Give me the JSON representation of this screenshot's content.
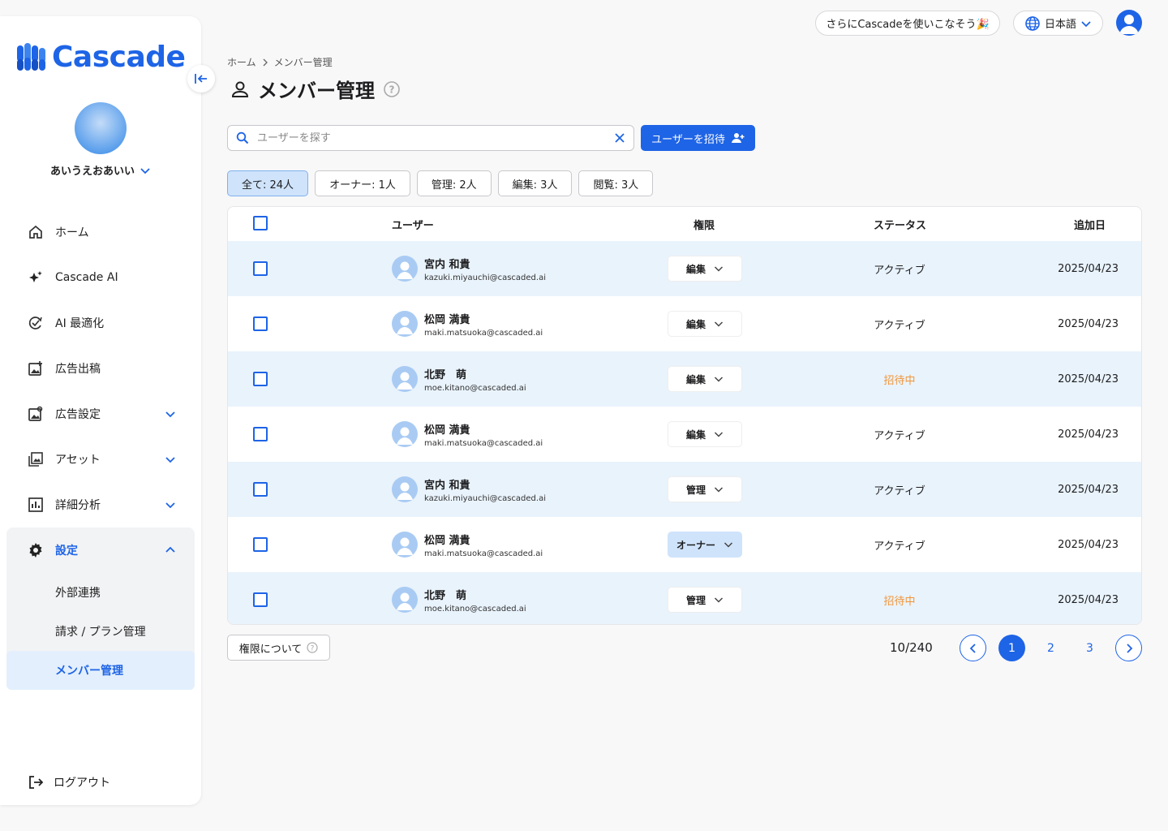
{
  "brand": {
    "name": "Cascade",
    "color": "#1e64e6"
  },
  "sidebar": {
    "org_name": "あいうえおあいい",
    "items": [
      {
        "label": "ホーム",
        "icon": "home-icon"
      },
      {
        "label": "Cascade AI",
        "icon": "sparkle-icon"
      },
      {
        "label": "AI 最適化",
        "icon": "optimize-icon"
      },
      {
        "label": "広告出稿",
        "icon": "ad-upload-icon"
      },
      {
        "label": "広告設定",
        "icon": "ad-settings-icon"
      },
      {
        "label": "アセット",
        "icon": "gallery-icon"
      },
      {
        "label": "詳細分析",
        "icon": "analytics-icon"
      },
      {
        "label": "設定",
        "icon": "gear-icon"
      }
    ],
    "sub_items": [
      {
        "label": "外部連携"
      },
      {
        "label": "請求 / プラン管理"
      },
      {
        "label": "メンバー管理"
      }
    ],
    "logout": "ログアウト"
  },
  "topbar": {
    "promo": "さらにCascadeを使いこなそう🎉",
    "language": "日本語"
  },
  "header": {
    "breadcrumb": [
      "ホーム",
      "メンバー管理"
    ],
    "title": "メンバー管理"
  },
  "search": {
    "placeholder": "ユーザーを探す",
    "value": ""
  },
  "invite_label": "ユーザーを招待",
  "filters": [
    {
      "label": "全て: 24人",
      "active": true
    },
    {
      "label": "オーナー: 1人",
      "active": false
    },
    {
      "label": "管理: 2人",
      "active": false
    },
    {
      "label": "編集: 3人",
      "active": false
    },
    {
      "label": "閲覧: 3人",
      "active": false
    }
  ],
  "table": {
    "columns": [
      "ユーザー",
      "権限",
      "ステータス",
      "追加日"
    ],
    "rows": [
      {
        "name": "宮内 和貴",
        "email": "kazuki.miyauchi@cascaded.ai",
        "role": "編集",
        "status": "アクティブ",
        "pending": false,
        "date": "2025/04/23"
      },
      {
        "name": "松岡 満貴",
        "email": "maki.matsuoka@cascaded.ai",
        "role": "編集",
        "status": "アクティブ",
        "pending": false,
        "date": "2025/04/23"
      },
      {
        "name": "北野　萌",
        "email": "moe.kitano@cascaded.ai",
        "role": "編集",
        "status": "招待中",
        "pending": true,
        "date": "2025/04/23"
      },
      {
        "name": "松岡 満貴",
        "email": "maki.matsuoka@cascaded.ai",
        "role": "編集",
        "status": "アクティブ",
        "pending": false,
        "date": "2025/04/23"
      },
      {
        "name": "宮内 和貴",
        "email": "kazuki.miyauchi@cascaded.ai",
        "role": "管理",
        "status": "アクティブ",
        "pending": false,
        "date": "2025/04/23"
      },
      {
        "name": "松岡 満貴",
        "email": "maki.matsuoka@cascaded.ai",
        "role": "オーナー",
        "status": "アクティブ",
        "pending": false,
        "date": "2025/04/23"
      },
      {
        "name": "北野　萌",
        "email": "moe.kitano@cascaded.ai",
        "role": "管理",
        "status": "招待中",
        "pending": true,
        "date": "2025/04/23"
      }
    ]
  },
  "footer": {
    "permissions_label": "権限について",
    "count": "10/240",
    "pages": [
      "1",
      "2",
      "3"
    ],
    "current_page": "1"
  },
  "colors": {
    "accent": "#1e64e6",
    "pending": "#f0963a",
    "row_alt": "#e9f3fc"
  }
}
